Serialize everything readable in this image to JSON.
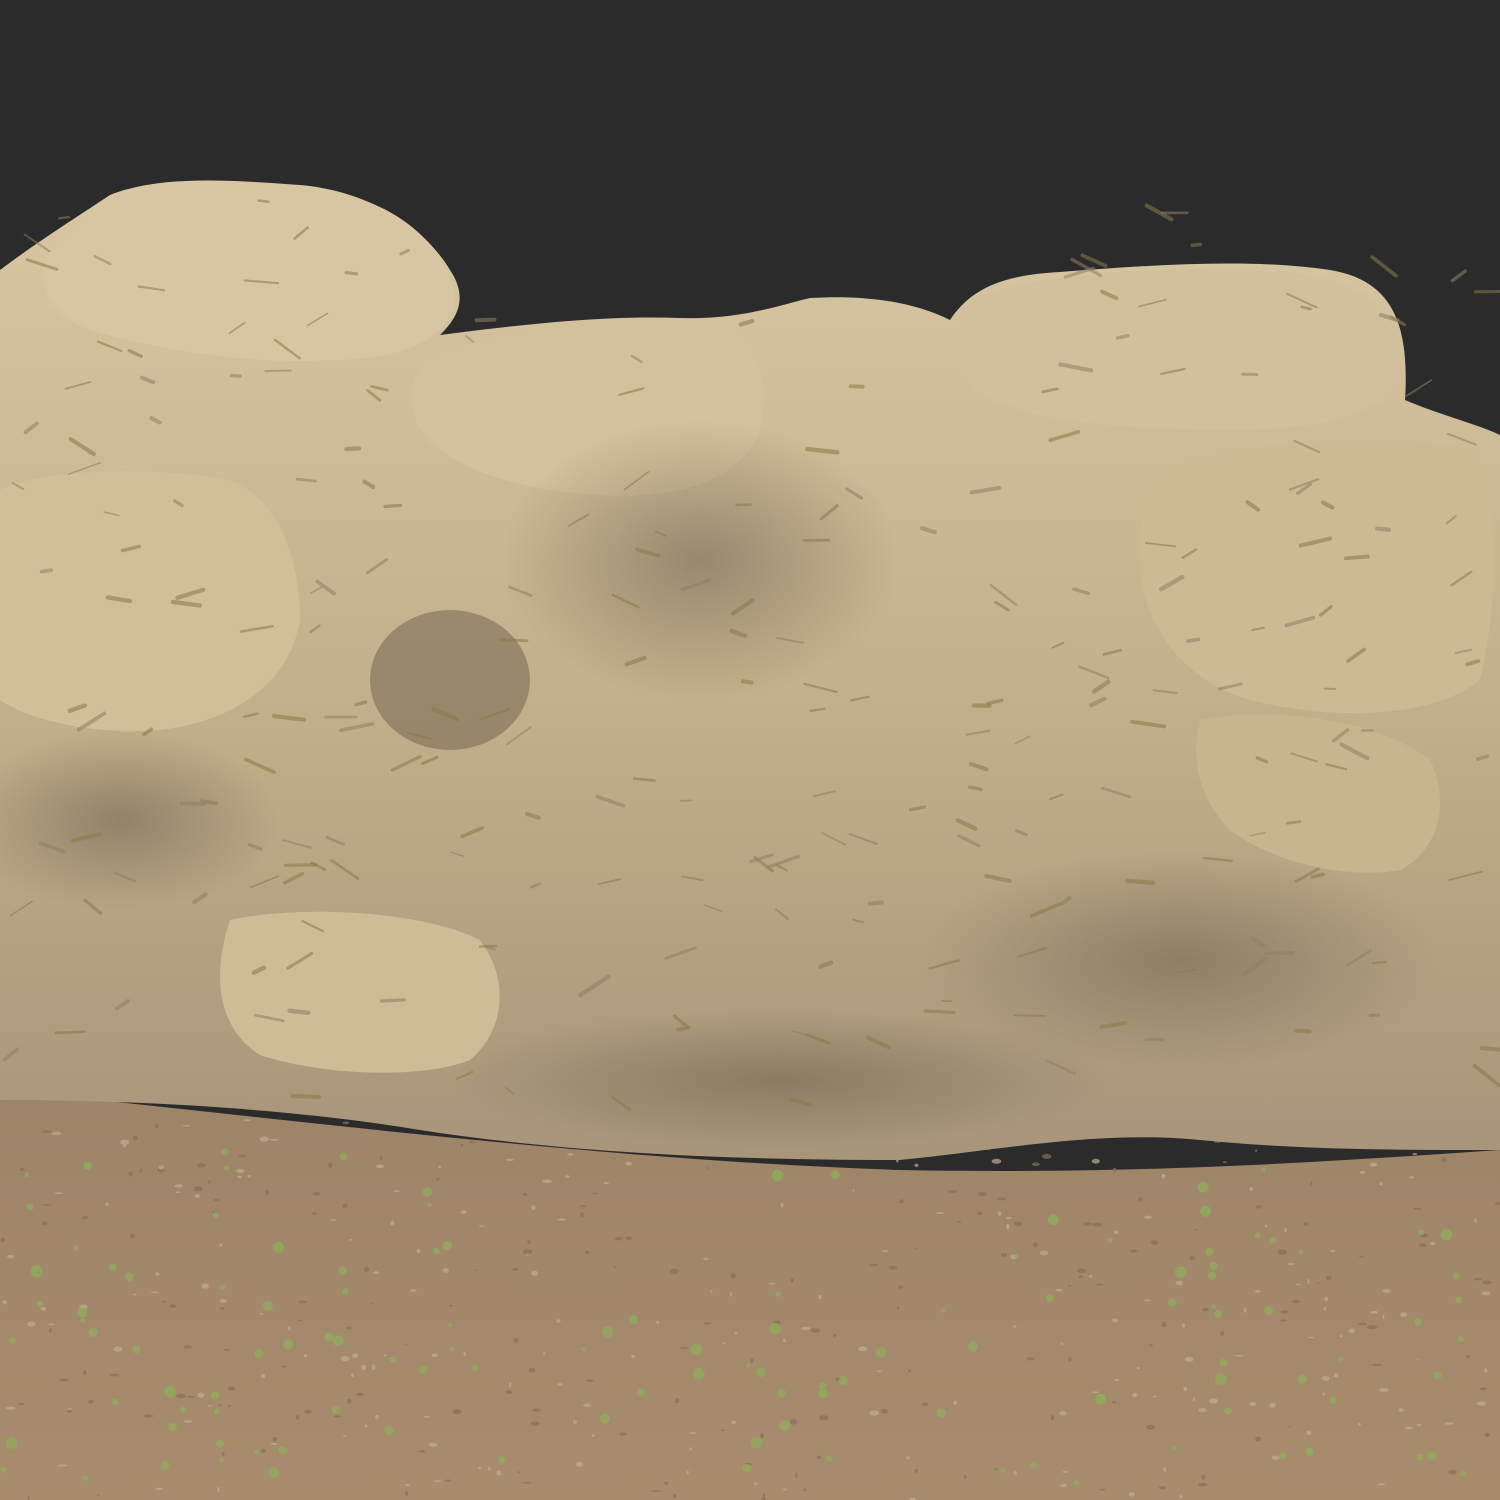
{
  "scene": {
    "subject": "rock-formation-render",
    "colors": {
      "background": "#2b2b2c",
      "rock_light": "#d6c3a0",
      "rock_mid": "#b9a47f",
      "rock_shadow": "#8f7f65",
      "moss": "#8a7a48",
      "ground": "#a58a6c",
      "ground_dark": "#8a6f55",
      "grass_tuft": "#8fae5a"
    }
  }
}
